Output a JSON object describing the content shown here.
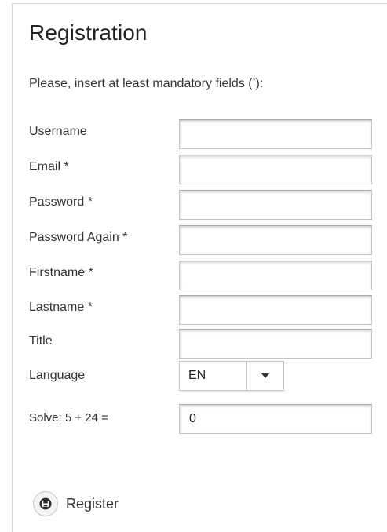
{
  "form": {
    "title": "Registration",
    "intro_text": "Please, insert at least mandatory fields (",
    "intro_mark": "*",
    "intro_end": "):",
    "fields": {
      "username": {
        "label": "Username",
        "value": ""
      },
      "email": {
        "label": "Email  *",
        "value": ""
      },
      "password": {
        "label": "Password  *",
        "value": ""
      },
      "password_again": {
        "label": "Password Again  *",
        "value": ""
      },
      "firstname": {
        "label": "Firstname  *",
        "value": ""
      },
      "lastname": {
        "label": "Lastname  *",
        "value": ""
      },
      "title": {
        "label": "Title",
        "value": ""
      }
    },
    "language": {
      "label": "Language",
      "selected": "EN"
    },
    "captcha": {
      "label": "Solve: 5 + 24 =",
      "value": "0"
    },
    "register": {
      "label": "Register",
      "icon": "floppy-disk-icon"
    }
  }
}
